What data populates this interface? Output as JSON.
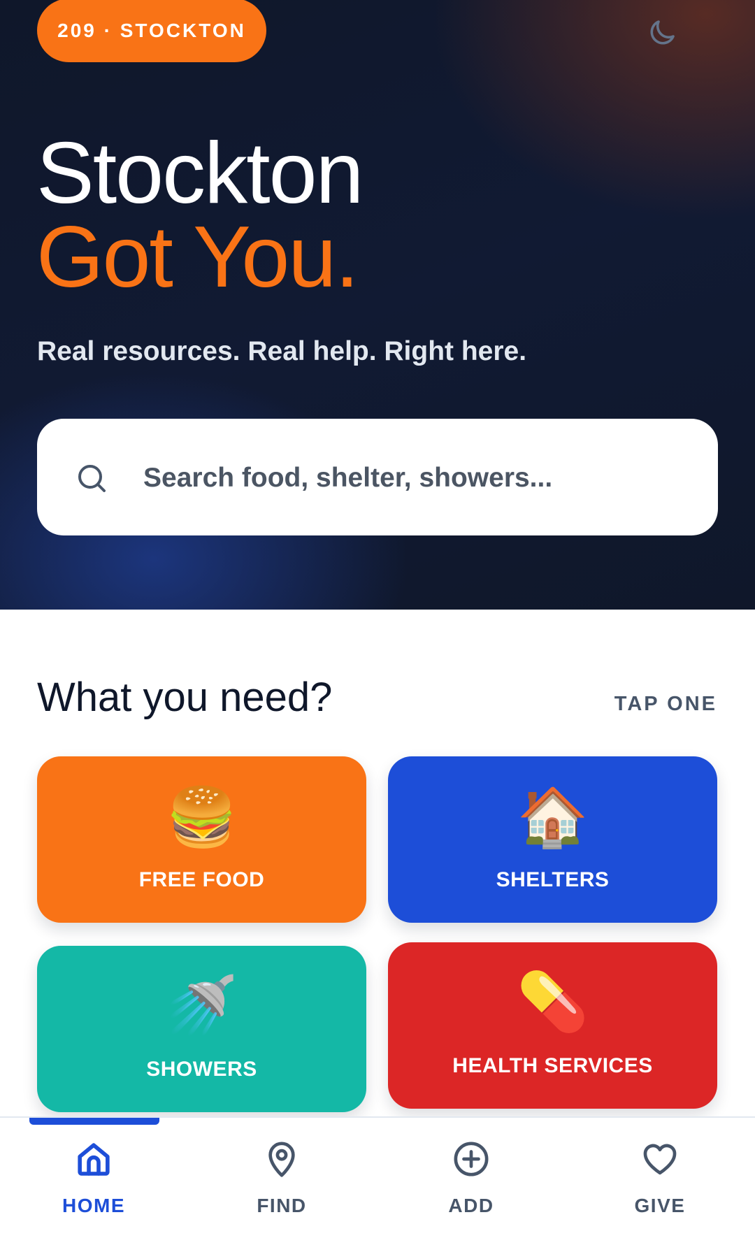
{
  "hero": {
    "badge": "209 · STOCKTON",
    "title_line1": "Stockton",
    "title_line2": "Got You.",
    "tagline": "Real resources. Real help. Right here.",
    "theme_icon": "moon-icon"
  },
  "search": {
    "placeholder": "Search food, shelter, showers...",
    "icon": "search-icon"
  },
  "needs": {
    "title": "What you need?",
    "hint": "TAP ONE",
    "cards": [
      {
        "label": "FREE FOOD",
        "emoji": "🍔",
        "color": "#f97316"
      },
      {
        "label": "SHELTERS",
        "emoji": "🏠",
        "color": "#1d4ed8"
      },
      {
        "label": "SHOWERS",
        "emoji": "🚿",
        "color": "#14b8a6"
      },
      {
        "label": "HEALTH SERVICES",
        "emoji": "💊",
        "color": "#dc2626"
      }
    ]
  },
  "nav": {
    "items": [
      {
        "label": "HOME",
        "icon": "home-icon",
        "active": true
      },
      {
        "label": "FIND",
        "icon": "map-pin-icon",
        "active": false
      },
      {
        "label": "ADD",
        "icon": "plus-circle-icon",
        "active": false
      },
      {
        "label": "GIVE",
        "icon": "heart-icon",
        "active": false
      }
    ]
  },
  "colors": {
    "accent": "#f97316",
    "primary": "#1d4ed8",
    "hero_bg": "#0f172a"
  }
}
